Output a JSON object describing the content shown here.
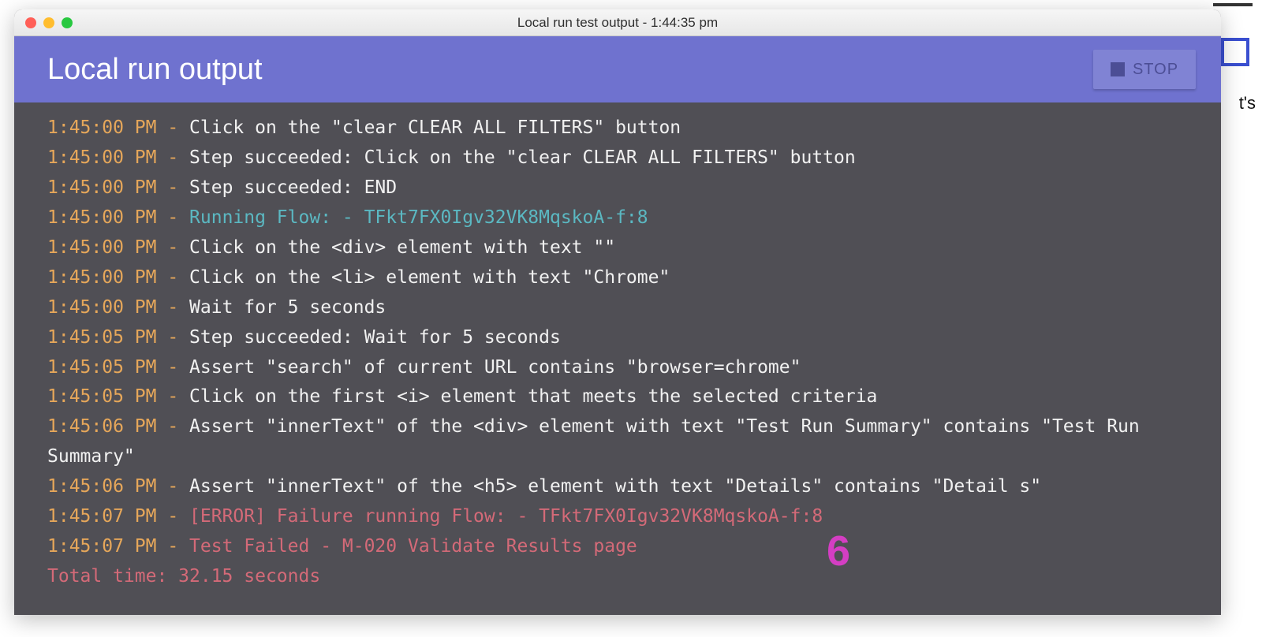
{
  "window": {
    "title": "Local run test output - 1:44:35 pm"
  },
  "header": {
    "title": "Local run output",
    "stop_label": "STOP"
  },
  "log": [
    {
      "ts": "1:45:00 PM",
      "style": "msg",
      "text": "Click on the \"clear CLEAR ALL FILTERS\" button"
    },
    {
      "ts": "1:45:00 PM",
      "style": "msg",
      "text": "Step succeeded: Click on the \"clear CLEAR ALL FILTERS\" button"
    },
    {
      "ts": "1:45:00 PM",
      "style": "msg",
      "text": "Step succeeded: END"
    },
    {
      "ts": "1:45:00 PM",
      "style": "cyan",
      "text": "Running Flow: - TFkt7FX0Igv32VK8MqskoA-f:8"
    },
    {
      "ts": "1:45:00 PM",
      "style": "msg",
      "text": "Click on the <div> element with text \"\""
    },
    {
      "ts": "1:45:00 PM",
      "style": "msg",
      "text": "Click on the <li> element with text \"Chrome\""
    },
    {
      "ts": "1:45:00 PM",
      "style": "msg",
      "text": "Wait for 5 seconds"
    },
    {
      "ts": "1:45:05 PM",
      "style": "msg",
      "text": "Step succeeded: Wait for 5 seconds"
    },
    {
      "ts": "1:45:05 PM",
      "style": "msg",
      "text": "Assert \"search\" of current URL contains \"browser=chrome\""
    },
    {
      "ts": "1:45:05 PM",
      "style": "msg",
      "text": "Click on the first <i> element that meets the selected criteria"
    },
    {
      "ts": "1:45:06 PM",
      "style": "msg",
      "text": "Assert \"innerText\" of the <div> element with text \"Test Run Summary\" contains \"Test Run Summary\""
    },
    {
      "ts": "1:45:06 PM",
      "style": "msg",
      "text": "Assert \"innerText\" of the <h5> element with text \"Details\" contains \"Detail s\""
    },
    {
      "ts": "1:45:07 PM",
      "style": "red",
      "text": "[ERROR] Failure running Flow: - TFkt7FX0Igv32VK8MqskoA-f:8"
    },
    {
      "ts": "1:45:07 PM",
      "style": "red",
      "text": "Test Failed - M-020 Validate Results page"
    }
  ],
  "total_line": "Total time: 32.15 seconds",
  "annotation": "6"
}
